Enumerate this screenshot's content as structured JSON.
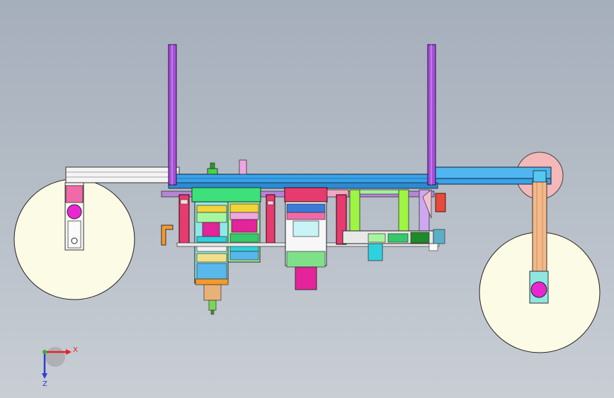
{
  "viewport": {
    "background_top": "#a5aebb",
    "background_bottom": "#c9ced5"
  },
  "triad": {
    "x_label": "X",
    "z_label": "Z",
    "x_color": "#e8202a",
    "z_color": "#2a3fd6",
    "y_color": "#2bb52b"
  },
  "colors": {
    "pulley_fill": "#fcfbe6",
    "pulley_pink": "#f4b8b8",
    "frame_purple": "#a64fd8",
    "beam_blue": "#3aa2e8",
    "rail_white": "#f2f2f2",
    "green": "#3de07a",
    "lime": "#9ef542",
    "magenta": "#e3249a",
    "pink_red": "#e63b6f",
    "cyan": "#2fd1e0",
    "orange_tan": "#f3b98a",
    "teal_light": "#8fe6e0"
  }
}
